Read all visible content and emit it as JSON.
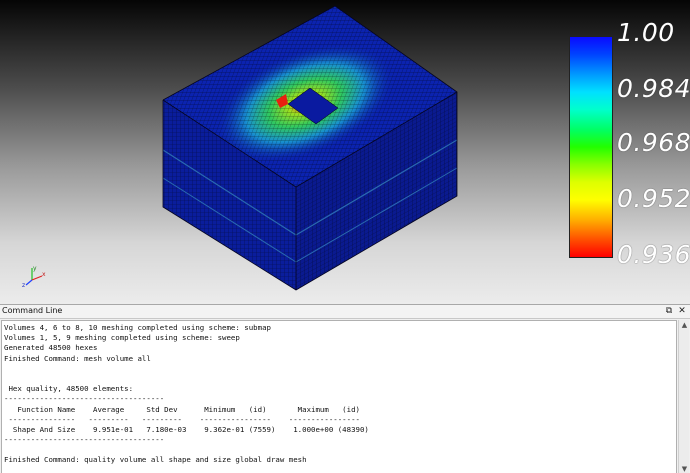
{
  "colorbar": {
    "labels": [
      "1.00",
      "0.984",
      "0.968",
      "0.952",
      "0.936"
    ]
  },
  "triad": {
    "x": "x",
    "y": "y",
    "z": "z"
  },
  "command_panel": {
    "title": "Command Line",
    "float_icon": "float-window-icon",
    "close_icon": "close-icon",
    "lines": [
      "Volumes 4, 6 to 8, 10 meshing completed using scheme: submap",
      "Volumes 1, 5, 9 meshing completed using scheme: sweep",
      "Generated 48500 hexes",
      "Finished Command: mesh volume all",
      "",
      "",
      " Hex quality, 48500 elements:",
      "------------------------------------",
      "   Function Name    Average     Std Dev      Minimum   (id)       Maximum   (id)",
      " ---------------   ---------   ---------    ----------------    ----------------",
      "  Shape And Size    9.951e-01   7.180e-03    9.362e-01 (7559)    1.000e+00 (48390)",
      "------------------------------------",
      "",
      "Finished Command: quality volume all shape and size global draw mesh"
    ]
  },
  "colors": {
    "mesh_base": "#0a1fa8",
    "mesh_high": "#1030d0",
    "hot_green": "#3cc83c",
    "hot_red": "#e02020"
  }
}
